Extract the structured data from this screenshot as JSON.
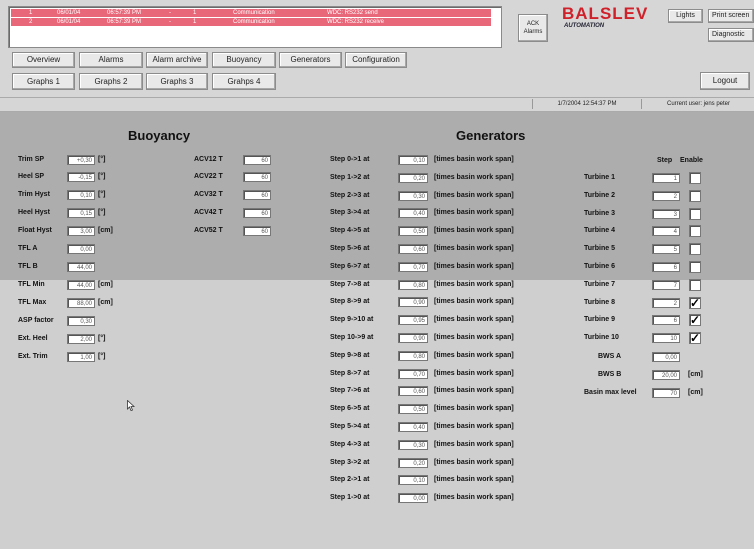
{
  "alarms": [
    {
      "num": "1",
      "date": "06/01/04",
      "time": "06:57:39 PM",
      "col3": "-",
      "col4": "1",
      "category": "Communication",
      "message": "WDC: RS232 send"
    },
    {
      "num": "2",
      "date": "06/01/04",
      "time": "06:57:39 PM",
      "col3": "-",
      "col4": "1",
      "category": "Communication",
      "message": "WDC: RS232 receive"
    }
  ],
  "ack_button": {
    "line1": "ACK",
    "line2": "Alarms"
  },
  "logo": {
    "main": "BALSLEV",
    "sub": "AUTOMATION"
  },
  "top_buttons": {
    "lights": "Lights",
    "print_screen": "Print screen",
    "diagnostic": "Diagnostic",
    "logout": "Logout"
  },
  "nav_row1": [
    "Overview",
    "Alarms",
    "Alarm archive",
    "Buoyancy",
    "Generators",
    "Configuration"
  ],
  "nav_row2": [
    "Graphs 1",
    "Graphs 2",
    "Graphs 3",
    "Grahps 4"
  ],
  "status": {
    "datetime": "1/7/2004 12:54:37 PM",
    "user": "Current user: jens peter"
  },
  "buoyancy": {
    "title": "Buoyancy",
    "params": [
      {
        "label": "Trim SP",
        "value": "+0,30",
        "unit": "[°]"
      },
      {
        "label": "Heel SP",
        "value": "-0,15",
        "unit": "[°]"
      },
      {
        "label": "Trim Hyst",
        "value": "0,10",
        "unit": "[°]"
      },
      {
        "label": "Heel Hyst",
        "value": "0,15",
        "unit": "[°]"
      },
      {
        "label": "Float Hyst",
        "value": "3,00",
        "unit": "[cm]"
      },
      {
        "label": "TFL A",
        "value": "0,00",
        "unit": ""
      },
      {
        "label": "TFL B",
        "value": "44,00",
        "unit": ""
      },
      {
        "label": "TFL Min",
        "value": "44,00",
        "unit": "[cm]"
      },
      {
        "label": "TFL Max",
        "value": "88,00",
        "unit": "[cm]"
      },
      {
        "label": "ASP factor",
        "value": "0,30",
        "unit": ""
      },
      {
        "label": "Ext. Heel",
        "value": "2,00",
        "unit": "[°]"
      },
      {
        "label": "Ext. Trim",
        "value": "1,00",
        "unit": "[°]"
      }
    ],
    "acv": [
      {
        "label": "ACV12 T",
        "value": "60"
      },
      {
        "label": "ACV22 T",
        "value": "60"
      },
      {
        "label": "ACV32 T",
        "value": "60"
      },
      {
        "label": "ACV42 T",
        "value": "60"
      },
      {
        "label": "ACV52 T",
        "value": "60"
      }
    ]
  },
  "generators": {
    "title": "Generators",
    "steps_unit": "[times basin work span]",
    "steps": [
      {
        "label": "Step 0->1 at",
        "value": "0,10"
      },
      {
        "label": "Step 1->2 at",
        "value": "0,20"
      },
      {
        "label": "Step 2->3 at",
        "value": "0,30"
      },
      {
        "label": "Step 3->4 at",
        "value": "0,40"
      },
      {
        "label": "Step 4->5 at",
        "value": "0,50"
      },
      {
        "label": "Step 5->6 at",
        "value": "0,60"
      },
      {
        "label": "Step 6->7 at",
        "value": "0,70"
      },
      {
        "label": "Step 7->8 at",
        "value": "0,80"
      },
      {
        "label": "Step 8->9 at",
        "value": "0,90"
      },
      {
        "label": "Step 9->10 at",
        "value": "0,95"
      },
      {
        "label": "Step 10->9 at",
        "value": "0,90"
      },
      {
        "label": "Step 9->8 at",
        "value": "0,80"
      },
      {
        "label": "Step 8->7 at",
        "value": "0,70"
      },
      {
        "label": "Step 7->6 at",
        "value": "0,60"
      },
      {
        "label": "Step 6->5 at",
        "value": "0,50"
      },
      {
        "label": "Step 5->4 at",
        "value": "0,40"
      },
      {
        "label": "Step 4->3 at",
        "value": "0,30"
      },
      {
        "label": "Step 3->2 at",
        "value": "0,20"
      },
      {
        "label": "Step 2->1 at",
        "value": "0,10"
      },
      {
        "label": "Step 1->0 at",
        "value": "0,00"
      }
    ],
    "turbine_header_step": "Step",
    "turbine_header_enable": "Enable",
    "turbines": [
      {
        "label": "Turbine 1",
        "step": "1",
        "enabled": false
      },
      {
        "label": "Turbine 2",
        "step": "2",
        "enabled": false
      },
      {
        "label": "Turbine 3",
        "step": "3",
        "enabled": false
      },
      {
        "label": "Turbine 4",
        "step": "4",
        "enabled": false
      },
      {
        "label": "Turbine 5",
        "step": "5",
        "enabled": false
      },
      {
        "label": "Turbine 6",
        "step": "6",
        "enabled": false
      },
      {
        "label": "Turbine 7",
        "step": "7",
        "enabled": false
      },
      {
        "label": "Turbine 8",
        "step": "2",
        "enabled": true
      },
      {
        "label": "Turbine 9",
        "step": "6",
        "enabled": true
      },
      {
        "label": "Turbine 10",
        "step": "10",
        "enabled": true
      }
    ],
    "extras": [
      {
        "label": "BWS A",
        "value": "0,00",
        "unit": ""
      },
      {
        "label": "BWS B",
        "value": "20,00",
        "unit": "[cm]"
      },
      {
        "label": "Basin max level",
        "value": "70",
        "unit": "[cm]"
      }
    ]
  },
  "check_mark": "✓"
}
